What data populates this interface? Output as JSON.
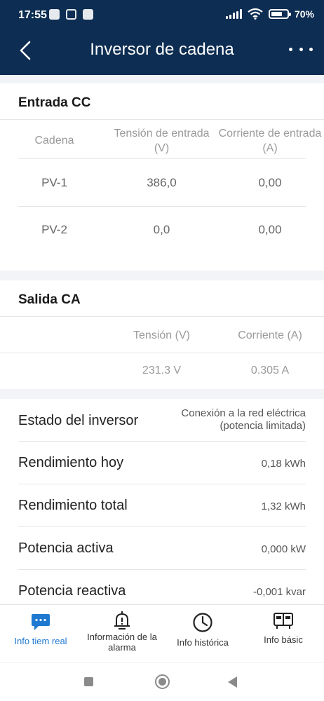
{
  "status": {
    "time": "17:55",
    "battery": "70%",
    "battery_level": 0.7
  },
  "header": {
    "title": "Inversor de cadena",
    "back_icon": "chevron-left-icon",
    "more_icon": "more-horizontal-icon"
  },
  "dc_input": {
    "title": "Entrada CC",
    "columns": [
      "Cadena",
      "Tensión de entrada (V)",
      "Corriente de entrada (A)"
    ],
    "rows": [
      {
        "string": "PV-1",
        "voltage": "386,0",
        "current": "0,00"
      },
      {
        "string": "PV-2",
        "voltage": "0,0",
        "current": "0,00"
      }
    ]
  },
  "ac_output": {
    "title": "Salida CA",
    "columns": [
      "Tensión (V)",
      "Corriente (A)"
    ],
    "values": {
      "voltage": "231.3 V",
      "current": "0.305 A"
    }
  },
  "info": [
    {
      "label": "Estado del inversor",
      "value": "Conexión a la red eléctrica (potencia limitada)"
    },
    {
      "label": "Rendimiento hoy",
      "value": "0,18 kWh"
    },
    {
      "label": "Rendimiento total",
      "value": "1,32 kWh"
    },
    {
      "label": "Potencia activa",
      "value": "0,000 kW"
    },
    {
      "label": "Potencia reactiva",
      "value": "-0,001 kvar"
    }
  ],
  "bottom_nav": [
    {
      "label": "Info tiem real",
      "icon": "realtime-chat-icon",
      "active": true
    },
    {
      "label": "Información de la alarma",
      "icon": "alarm-bell-icon",
      "active": false
    },
    {
      "label": "Info histórica",
      "icon": "clock-icon",
      "active": false
    },
    {
      "label": "Info básic",
      "icon": "device-info-icon",
      "active": false
    }
  ],
  "colors": {
    "header_bg": "#0d2d52",
    "accent": "#1f79d1"
  }
}
